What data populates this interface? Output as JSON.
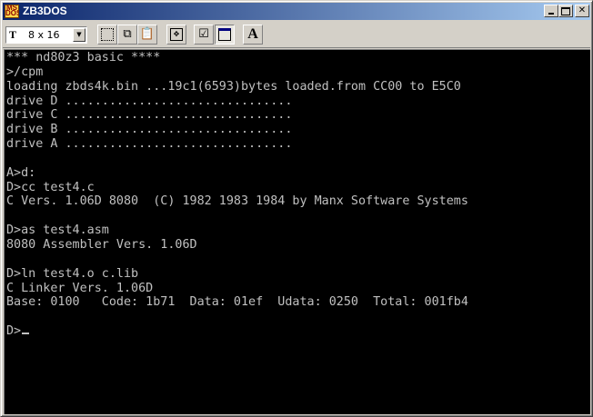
{
  "window": {
    "title": "ZB3DOS"
  },
  "titlebar": {
    "icon": "msdos-icon",
    "minimize_icon": "minimize-icon",
    "maximize_icon": "maximize-icon",
    "close_icon": "close-icon"
  },
  "toolbar": {
    "font_size_value": "8 x 16",
    "tools": [
      {
        "name": "mark-icon"
      },
      {
        "name": "copy-icon"
      },
      {
        "name": "paste-icon"
      },
      {
        "name": "fullscreen-icon"
      },
      {
        "name": "properties-icon"
      },
      {
        "name": "background-icon"
      },
      {
        "name": "font-icon"
      }
    ]
  },
  "console": {
    "lines": [
      "*** nd80z3 basic ****",
      ">/cpm",
      "loading zbds4k.bin ...19c1(6593)bytes loaded.from CC00 to E5C0",
      "drive D ...............................",
      "drive C ...............................",
      "drive B ...............................",
      "drive A ...............................",
      "",
      "A>d:",
      "D>cc test4.c",
      "C Vers. 1.06D 8080  (C) 1982 1983 1984 by Manx Software Systems",
      "",
      "D>as test4.asm",
      "8080 Assembler Vers. 1.06D",
      "",
      "D>ln test4.o c.lib",
      "C Linker Vers. 1.06D",
      "Base: 0100   Code: 1b71  Data: 01ef  Udata: 0250  Total: 001fb4",
      "",
      "D>"
    ],
    "text_color": "#c0c0c0",
    "background_color": "#000000"
  }
}
